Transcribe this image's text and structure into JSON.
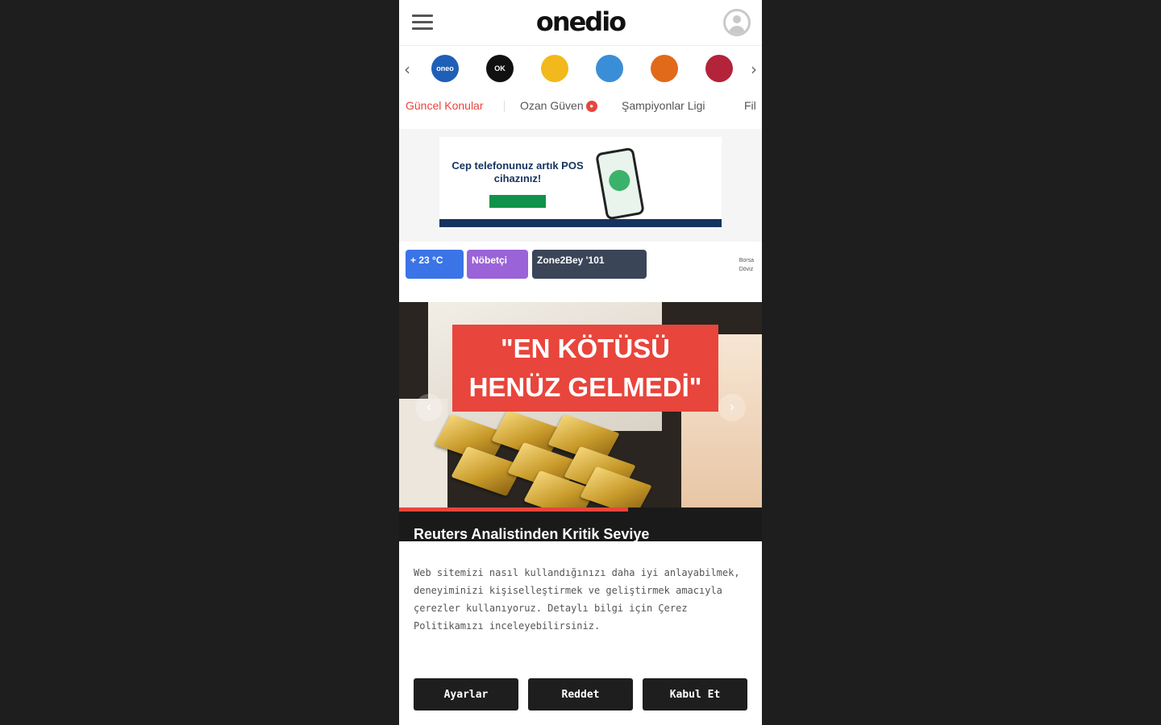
{
  "header": {
    "logo": "onedio"
  },
  "channels": [
    {
      "name": "channel-blue",
      "label": "oneo",
      "color": "#1f5fb8"
    },
    {
      "name": "channel-ok",
      "label": "OK",
      "color": "#111111"
    },
    {
      "name": "channel-yellow",
      "label": "",
      "color": "#f2b91c"
    },
    {
      "name": "channel-gear",
      "label": "",
      "color": "#3a8ed8"
    },
    {
      "name": "channel-orange",
      "label": "",
      "color": "#e06a1a"
    },
    {
      "name": "channel-red",
      "label": "",
      "color": "#b3233a"
    }
  ],
  "trending": {
    "items": [
      "Güncel Konular",
      "Ozan Güven",
      "Şampiyonlar Ligi",
      "Fil"
    ]
  },
  "ad": {
    "headline": "Cep telefonunuz artık POS cihazınız!",
    "cta": "",
    "brand": ""
  },
  "widgets": [
    {
      "label": "",
      "value": "+ 23 °C",
      "color": "#3b74e6"
    },
    {
      "label": "",
      "value": "Nöbetçi",
      "color": "#9a63d8"
    },
    {
      "label": "",
      "value": "Zone2Bey '101",
      "color": "#3a4558"
    }
  ],
  "mini_info": [
    "Borsa",
    "Döviz"
  ],
  "hero": {
    "banner_line1": "\"EN KÖTÜSÜ",
    "banner_line2": "HENÜZ GELMEDİ\"",
    "caption": "Reuters Analistinden Kritik Seviye",
    "progress": 0.63,
    "prev_icon": "chevron-left-icon",
    "next_icon": "chevron-right-icon"
  },
  "cookie": {
    "text": "Web sitemizi nasıl kullandığınızı daha iyi anlayabilmek, deneyiminizi kişiselleştirmek ve geliştirmek amacıyla çerezler kullanıyoruz. Detaylı bilgi için Çerez Politikamızı inceleyebilirsiniz.",
    "settings_label": "Ayarlar",
    "reject_label": "Reddet",
    "accept_label": "Kabul Et"
  },
  "colors": {
    "accent": "#e8453c",
    "dark": "#1e1e1e"
  }
}
